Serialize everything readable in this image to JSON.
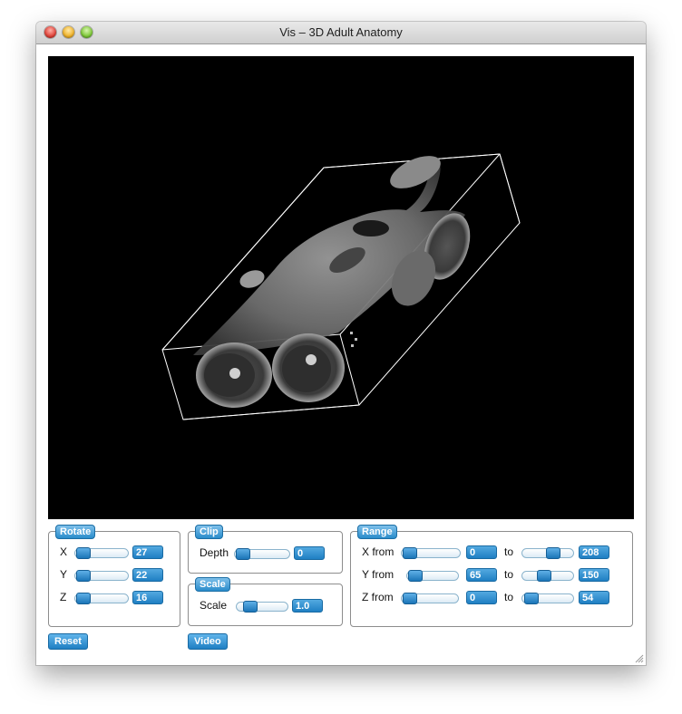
{
  "window": {
    "title": "Vis – 3D Adult Anatomy"
  },
  "rotate": {
    "legend": "Rotate",
    "rows": [
      {
        "label": "X",
        "value": "27"
      },
      {
        "label": "Y",
        "value": "22"
      },
      {
        "label": "Z",
        "value": "16"
      }
    ]
  },
  "clip": {
    "legend": "Clip",
    "label": "Depth",
    "value": "0"
  },
  "scale": {
    "legend": "Scale",
    "label": "Scale",
    "value": "1.0"
  },
  "range": {
    "legend": "Range",
    "to_label": "to",
    "rows": [
      {
        "label": "X from",
        "from": "0",
        "to": "208"
      },
      {
        "label": "Y from",
        "from": "65",
        "to": "150"
      },
      {
        "label": "Z from",
        "from": "0",
        "to": "54"
      }
    ]
  },
  "buttons": {
    "reset": "Reset",
    "video": "Video"
  },
  "colors": {
    "accent": "#1f7fc3",
    "viewport_bg": "#000000"
  }
}
